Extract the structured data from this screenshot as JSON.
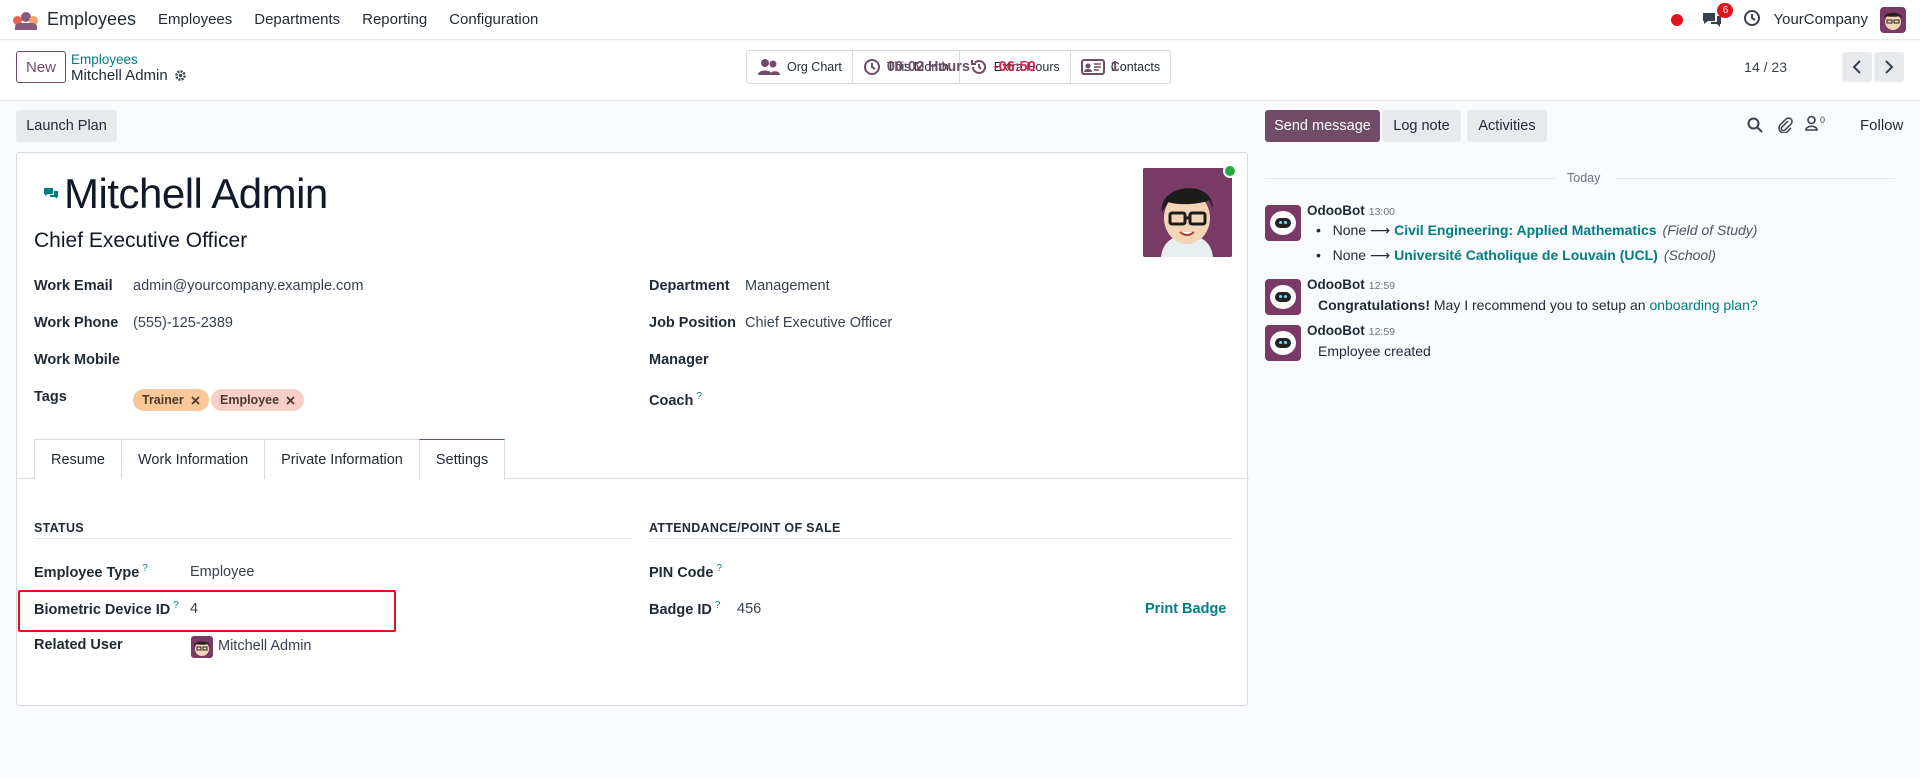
{
  "navbar": {
    "app_name": "Employees",
    "menu": [
      "Employees",
      "Departments",
      "Reporting",
      "Configuration"
    ],
    "chat_count": "6",
    "company": "YourCompany"
  },
  "control": {
    "new_label": "New",
    "breadcrumb_parent": "Employees",
    "breadcrumb_current": "Mitchell Admin",
    "smart_buttons": [
      {
        "icon": "org-chart-icon",
        "label": "Org Chart",
        "value": ""
      },
      {
        "icon": "clock-icon",
        "label": "This Month",
        "value": "00:02 Hours"
      },
      {
        "icon": "history-icon",
        "label": "Extra Hours",
        "value": "-06:50"
      },
      {
        "icon": "contact-card-icon",
        "label": "Contacts",
        "value": "1"
      }
    ],
    "pager": "14 / 23"
  },
  "form": {
    "launch_plan": "Launch Plan",
    "name": "Mitchell Admin",
    "job_title": "Chief Executive Officer",
    "fields_left": {
      "work_email_label": "Work Email",
      "work_email": "admin@yourcompany.example.com",
      "work_phone_label": "Work Phone",
      "work_phone": "(555)-125-2389",
      "work_mobile_label": "Work Mobile",
      "tags_label": "Tags",
      "tags": [
        "Trainer",
        "Employee"
      ]
    },
    "fields_right": {
      "department_label": "Department",
      "department": "Management",
      "job_position_label": "Job Position",
      "job_position": "Chief Executive Officer",
      "manager_label": "Manager",
      "coach_label": "Coach"
    },
    "tabs": [
      "Resume",
      "Work Information",
      "Private Information",
      "Settings"
    ],
    "active_tab": "Settings",
    "settings": {
      "status_title": "STATUS",
      "employee_type_label": "Employee Type",
      "employee_type": "Employee",
      "biometric_label": "Biometric Device ID",
      "biometric": "4",
      "related_user_label": "Related User",
      "related_user": "Mitchell Admin",
      "attendance_title": "ATTENDANCE/POINT OF SALE",
      "pin_label": "PIN Code",
      "badge_label": "Badge ID",
      "badge": "456",
      "print_badge": "Print Badge"
    },
    "help_mark": "?"
  },
  "chatter": {
    "send_message": "Send message",
    "log_note": "Log note",
    "activities": "Activities",
    "followers_count": "0",
    "follow": "Follow",
    "today": "Today",
    "messages": [
      {
        "author": "OdooBot",
        "time": "13:00",
        "changes": [
          {
            "old": "None",
            "new": "Civil Engineering: Applied Mathematics",
            "field": "(Field of Study)"
          },
          {
            "old": "None",
            "new": "Université Catholique de Louvain (UCL)",
            "field": "(School)"
          }
        ]
      },
      {
        "author": "OdooBot",
        "time": "12:59",
        "bold": "Congratulations!",
        "text": " May I recommend you to setup an ",
        "link": "onboarding plan?"
      },
      {
        "author": "OdooBot",
        "time": "12:59",
        "text": "Employee created"
      }
    ]
  },
  "colors": {
    "brand": "#714b67",
    "link": "#017e84",
    "alert": "#e2131a"
  }
}
